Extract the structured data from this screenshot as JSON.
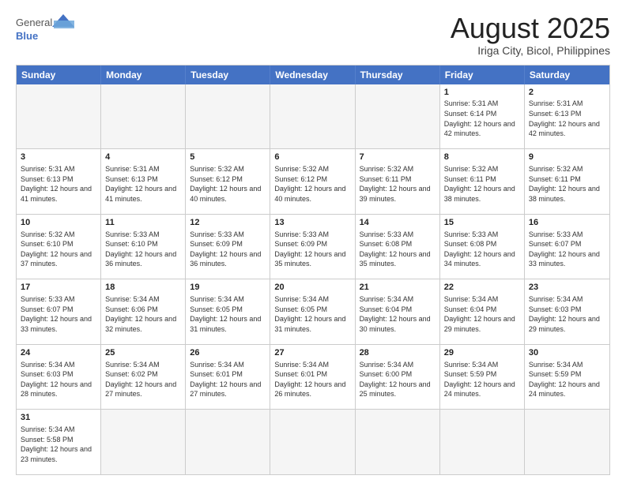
{
  "header": {
    "logo_general": "General",
    "logo_blue": "Blue",
    "month_title": "August 2025",
    "subtitle": "Iriga City, Bicol, Philippines"
  },
  "days_of_week": [
    "Sunday",
    "Monday",
    "Tuesday",
    "Wednesday",
    "Thursday",
    "Friday",
    "Saturday"
  ],
  "weeks": [
    [
      {
        "day": "",
        "empty": true
      },
      {
        "day": "",
        "empty": true
      },
      {
        "day": "",
        "empty": true
      },
      {
        "day": "",
        "empty": true
      },
      {
        "day": "",
        "empty": true
      },
      {
        "day": "1",
        "info": "Sunrise: 5:31 AM\nSunset: 6:14 PM\nDaylight: 12 hours\nand 42 minutes."
      },
      {
        "day": "2",
        "info": "Sunrise: 5:31 AM\nSunset: 6:13 PM\nDaylight: 12 hours\nand 42 minutes."
      }
    ],
    [
      {
        "day": "3",
        "info": "Sunrise: 5:31 AM\nSunset: 6:13 PM\nDaylight: 12 hours\nand 41 minutes."
      },
      {
        "day": "4",
        "info": "Sunrise: 5:31 AM\nSunset: 6:13 PM\nDaylight: 12 hours\nand 41 minutes."
      },
      {
        "day": "5",
        "info": "Sunrise: 5:32 AM\nSunset: 6:12 PM\nDaylight: 12 hours\nand 40 minutes."
      },
      {
        "day": "6",
        "info": "Sunrise: 5:32 AM\nSunset: 6:12 PM\nDaylight: 12 hours\nand 40 minutes."
      },
      {
        "day": "7",
        "info": "Sunrise: 5:32 AM\nSunset: 6:11 PM\nDaylight: 12 hours\nand 39 minutes."
      },
      {
        "day": "8",
        "info": "Sunrise: 5:32 AM\nSunset: 6:11 PM\nDaylight: 12 hours\nand 38 minutes."
      },
      {
        "day": "9",
        "info": "Sunrise: 5:32 AM\nSunset: 6:11 PM\nDaylight: 12 hours\nand 38 minutes."
      }
    ],
    [
      {
        "day": "10",
        "info": "Sunrise: 5:32 AM\nSunset: 6:10 PM\nDaylight: 12 hours\nand 37 minutes."
      },
      {
        "day": "11",
        "info": "Sunrise: 5:33 AM\nSunset: 6:10 PM\nDaylight: 12 hours\nand 36 minutes."
      },
      {
        "day": "12",
        "info": "Sunrise: 5:33 AM\nSunset: 6:09 PM\nDaylight: 12 hours\nand 36 minutes."
      },
      {
        "day": "13",
        "info": "Sunrise: 5:33 AM\nSunset: 6:09 PM\nDaylight: 12 hours\nand 35 minutes."
      },
      {
        "day": "14",
        "info": "Sunrise: 5:33 AM\nSunset: 6:08 PM\nDaylight: 12 hours\nand 35 minutes."
      },
      {
        "day": "15",
        "info": "Sunrise: 5:33 AM\nSunset: 6:08 PM\nDaylight: 12 hours\nand 34 minutes."
      },
      {
        "day": "16",
        "info": "Sunrise: 5:33 AM\nSunset: 6:07 PM\nDaylight: 12 hours\nand 33 minutes."
      }
    ],
    [
      {
        "day": "17",
        "info": "Sunrise: 5:33 AM\nSunset: 6:07 PM\nDaylight: 12 hours\nand 33 minutes."
      },
      {
        "day": "18",
        "info": "Sunrise: 5:34 AM\nSunset: 6:06 PM\nDaylight: 12 hours\nand 32 minutes."
      },
      {
        "day": "19",
        "info": "Sunrise: 5:34 AM\nSunset: 6:05 PM\nDaylight: 12 hours\nand 31 minutes."
      },
      {
        "day": "20",
        "info": "Sunrise: 5:34 AM\nSunset: 6:05 PM\nDaylight: 12 hours\nand 31 minutes."
      },
      {
        "day": "21",
        "info": "Sunrise: 5:34 AM\nSunset: 6:04 PM\nDaylight: 12 hours\nand 30 minutes."
      },
      {
        "day": "22",
        "info": "Sunrise: 5:34 AM\nSunset: 6:04 PM\nDaylight: 12 hours\nand 29 minutes."
      },
      {
        "day": "23",
        "info": "Sunrise: 5:34 AM\nSunset: 6:03 PM\nDaylight: 12 hours\nand 29 minutes."
      }
    ],
    [
      {
        "day": "24",
        "info": "Sunrise: 5:34 AM\nSunset: 6:03 PM\nDaylight: 12 hours\nand 28 minutes."
      },
      {
        "day": "25",
        "info": "Sunrise: 5:34 AM\nSunset: 6:02 PM\nDaylight: 12 hours\nand 27 minutes."
      },
      {
        "day": "26",
        "info": "Sunrise: 5:34 AM\nSunset: 6:01 PM\nDaylight: 12 hours\nand 27 minutes."
      },
      {
        "day": "27",
        "info": "Sunrise: 5:34 AM\nSunset: 6:01 PM\nDaylight: 12 hours\nand 26 minutes."
      },
      {
        "day": "28",
        "info": "Sunrise: 5:34 AM\nSunset: 6:00 PM\nDaylight: 12 hours\nand 25 minutes."
      },
      {
        "day": "29",
        "info": "Sunrise: 5:34 AM\nSunset: 5:59 PM\nDaylight: 12 hours\nand 24 minutes."
      },
      {
        "day": "30",
        "info": "Sunrise: 5:34 AM\nSunset: 5:59 PM\nDaylight: 12 hours\nand 24 minutes."
      }
    ],
    [
      {
        "day": "31",
        "info": "Sunrise: 5:34 AM\nSunset: 5:58 PM\nDaylight: 12 hours\nand 23 minutes."
      },
      {
        "day": "",
        "empty": true
      },
      {
        "day": "",
        "empty": true
      },
      {
        "day": "",
        "empty": true
      },
      {
        "day": "",
        "empty": true
      },
      {
        "day": "",
        "empty": true
      },
      {
        "day": "",
        "empty": true
      }
    ]
  ]
}
